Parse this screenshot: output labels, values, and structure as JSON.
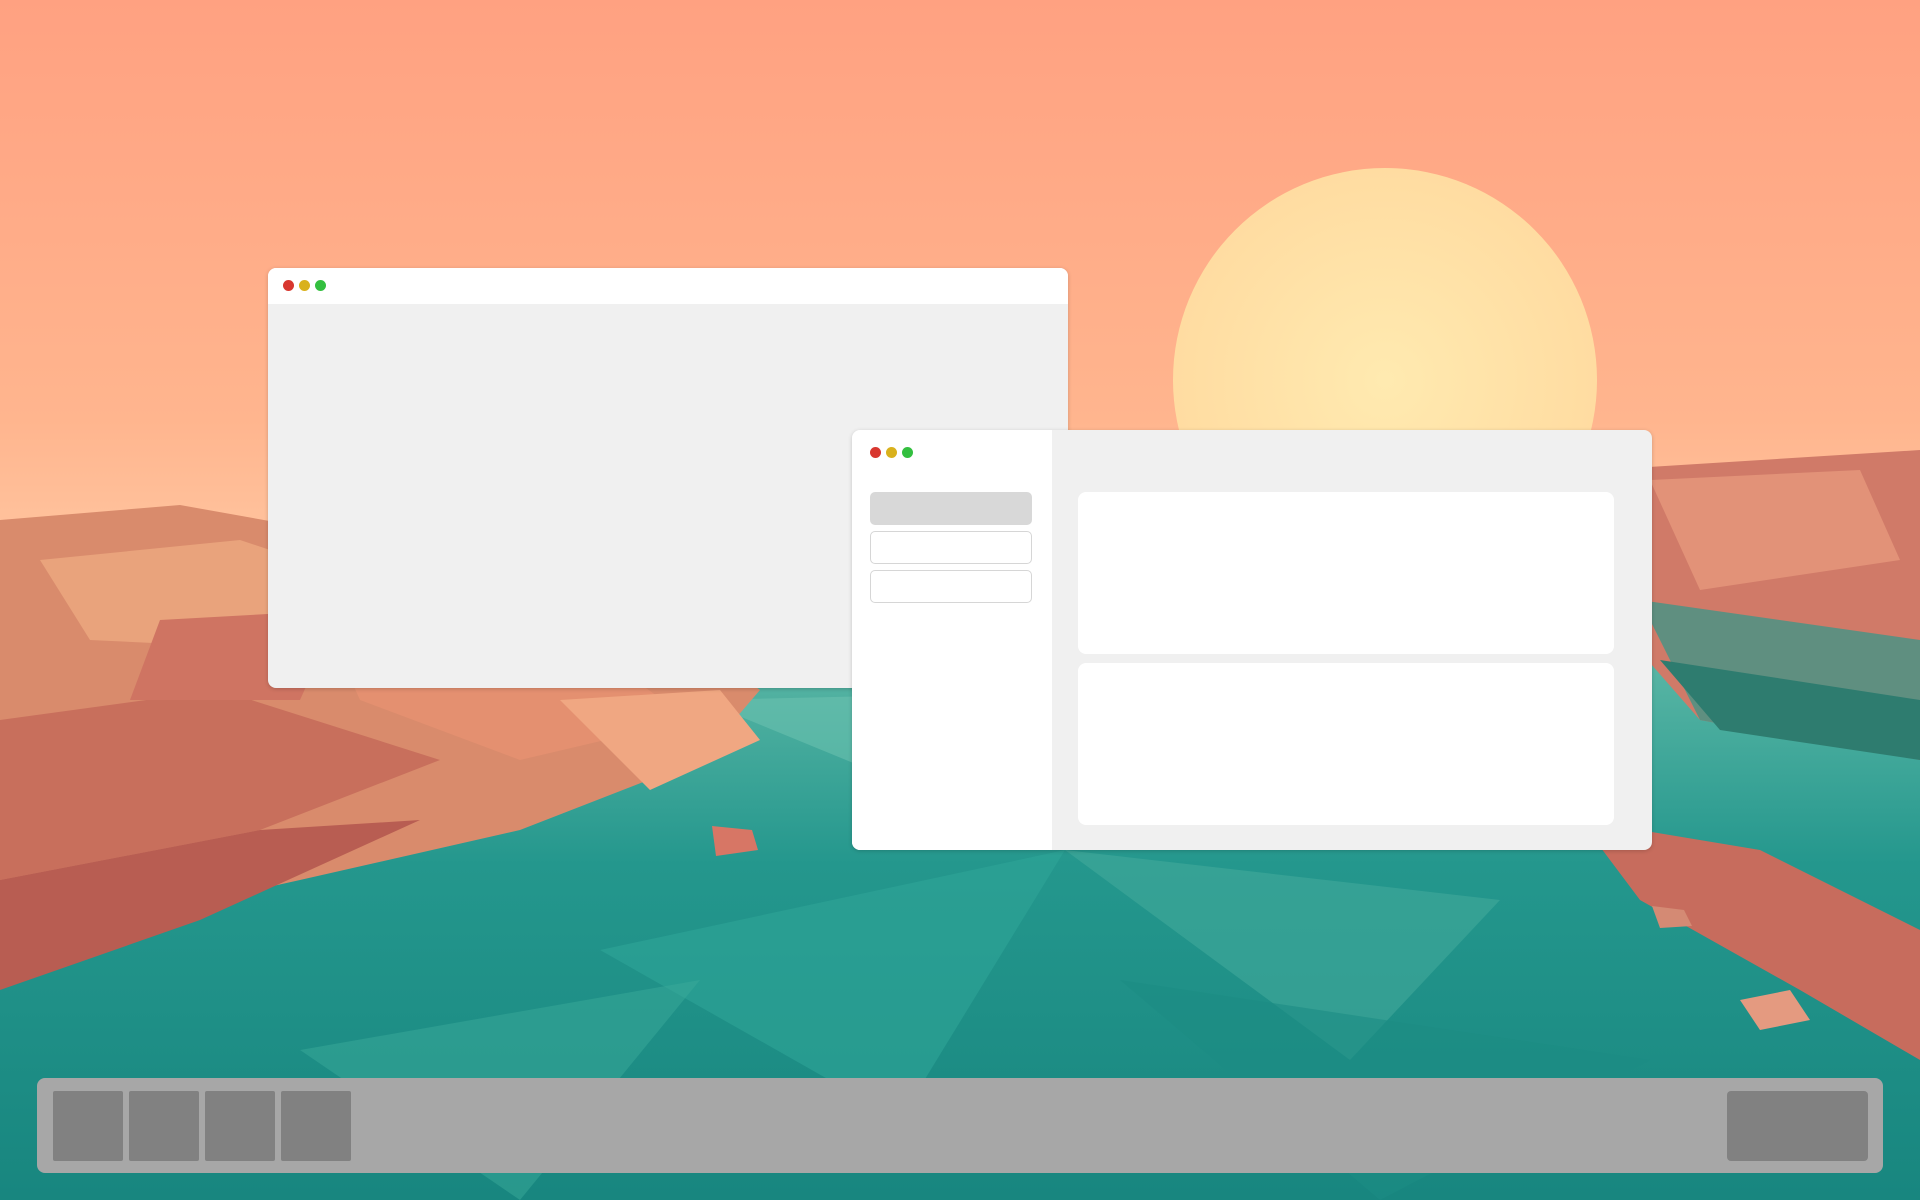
{
  "desktop": {
    "wallpaper": {
      "sky_top": "#ffa384",
      "sky_bottom": "#ffc0a0",
      "sun_color": "#ffe7a8",
      "water_color": "#1f9a8f",
      "rock_color": "#d9846a"
    }
  },
  "windows": [
    {
      "id": "back-window",
      "controls": [
        "close",
        "minimize",
        "maximize"
      ]
    },
    {
      "id": "front-window",
      "controls": [
        "close",
        "minimize",
        "maximize"
      ],
      "sidebar": {
        "items": [
          {
            "state": "selected"
          },
          {
            "state": "normal"
          },
          {
            "state": "normal"
          }
        ]
      },
      "panels": 2
    }
  ],
  "taskbar": {
    "buttons": 4,
    "tray": 1
  }
}
